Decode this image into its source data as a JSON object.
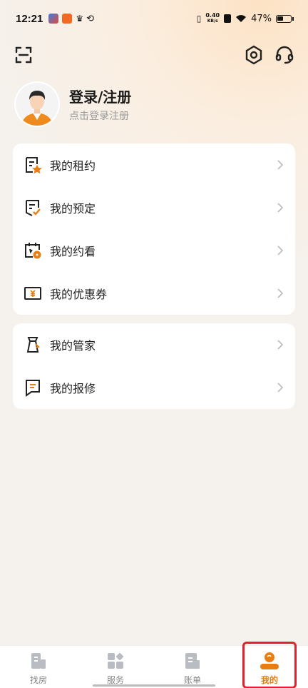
{
  "status_bar": {
    "time": "12:21",
    "net_speed_value": "0.40",
    "net_speed_unit": "KB/s",
    "battery": "47%"
  },
  "profile": {
    "title": "登录/注册",
    "subtitle": "点击登录注册"
  },
  "menu_group_1": [
    {
      "label": "我的租约",
      "icon": "lease-icon"
    },
    {
      "label": "我的预定",
      "icon": "reservation-icon"
    },
    {
      "label": "我的约看",
      "icon": "appointment-icon"
    },
    {
      "label": "我的优惠券",
      "icon": "coupon-icon"
    }
  ],
  "menu_group_2": [
    {
      "label": "我的管家",
      "icon": "butler-icon"
    },
    {
      "label": "我的报修",
      "icon": "repair-icon"
    }
  ],
  "tabbar": {
    "tabs": [
      {
        "label": "找房",
        "icon": "building-icon",
        "active": false
      },
      {
        "label": "服务",
        "icon": "grid-icon",
        "active": false
      },
      {
        "label": "账单",
        "icon": "bill-icon",
        "active": false
      },
      {
        "label": "我的",
        "icon": "user-icon",
        "active": true
      }
    ]
  },
  "colors": {
    "accent": "#e87d14",
    "highlight": "#e0202a"
  }
}
